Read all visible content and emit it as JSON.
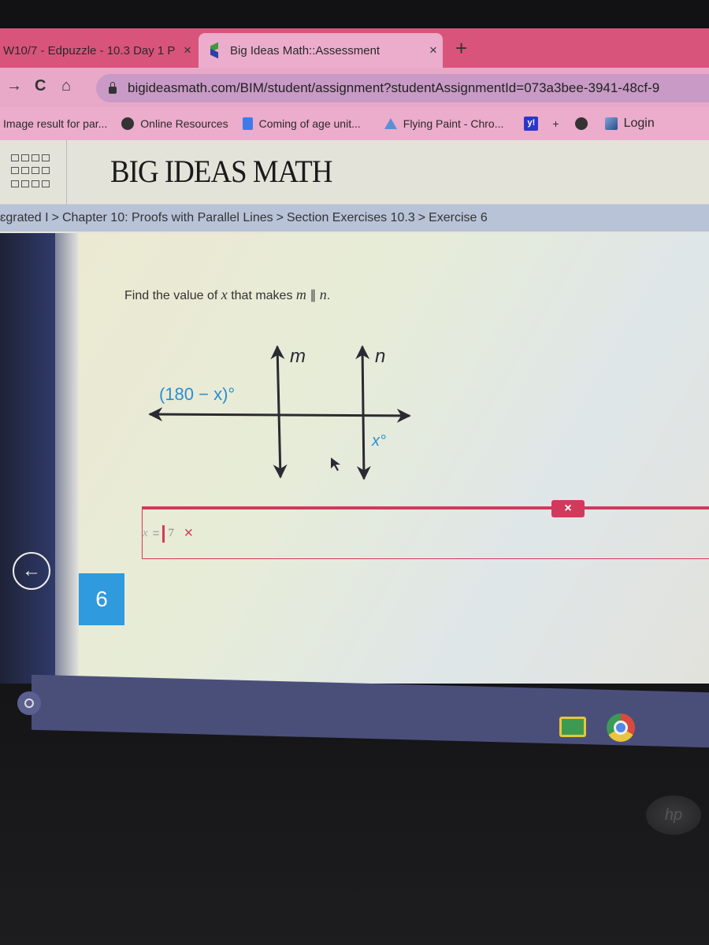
{
  "browser": {
    "tabs": [
      {
        "title": "W10/7 - Edpuzzle - 10.3 Day 1 P",
        "active": false,
        "close_icon": "×"
      },
      {
        "title": "Big Ideas Math::Assessment",
        "active": true,
        "close_icon": "×"
      }
    ],
    "new_tab_label": "+",
    "nav": {
      "forward": "→",
      "reload": "C",
      "home": "⌂"
    },
    "url": "bigideasmath.com/BIM/student/assignment?studentAssignmentId=073a3bee-3941-48cf-9",
    "bookmarks": [
      {
        "label": "Image result for par...",
        "icon": "none"
      },
      {
        "label": "Online Resources",
        "icon": "globe-icon"
      },
      {
        "label": "Coming of age unit...",
        "icon": "docs-icon"
      },
      {
        "label": "Flying Paint - Chro...",
        "icon": "drive-icon"
      },
      {
        "label": "y!",
        "icon": "yahoo-icon"
      },
      {
        "label": "+",
        "icon": "none"
      },
      {
        "label": "",
        "icon": "globe-icon"
      },
      {
        "label": "Login",
        "icon": "skf-icon"
      }
    ]
  },
  "page": {
    "brand": "BIG IDEAS MATH",
    "breadcrumb": [
      "ɛgrated I",
      "Chapter 10: Proofs with Parallel Lines",
      "Section Exercises 10.3",
      "Exercise 6"
    ],
    "breadcrumb_separator": ">",
    "exercise_number": "6",
    "back_icon": "←",
    "question": {
      "prefix": "Find the value of ",
      "var": "x",
      "middle": " that makes ",
      "line1": "m",
      "parallel": " ∥ ",
      "line2": "n",
      "suffix": "."
    },
    "diagram": {
      "line_labels": [
        "m",
        "n"
      ],
      "angle_left": "(180 − x)°",
      "angle_right": "x°",
      "label_color": "#2a8fd1"
    },
    "answer": {
      "variable": "x",
      "equals": "=",
      "value": "7",
      "status": "incorrect",
      "status_mark": "×",
      "clear_label": "×",
      "accent_color": "#d23a5d"
    }
  },
  "shelf": {
    "apps": [
      "launcher",
      "Google Classroom",
      "Google Chrome"
    ]
  },
  "device": {
    "logo": "hp"
  }
}
